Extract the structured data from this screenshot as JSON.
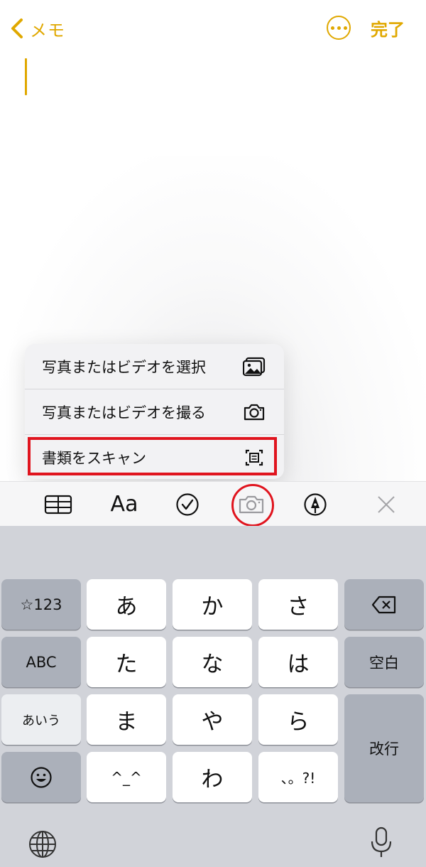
{
  "nav": {
    "back_label": "メモ",
    "done_label": "完了"
  },
  "menu": {
    "items": [
      {
        "label": "写真またはビデオを選択",
        "icon": "photo-library-icon"
      },
      {
        "label": "写真またはビデオを撮る",
        "icon": "camera-icon"
      },
      {
        "label": "書類をスキャン",
        "icon": "scan-document-icon"
      }
    ]
  },
  "toolbar": {
    "format_label": "Aa"
  },
  "keyboard": {
    "symbols": "☆123",
    "abc": "ABC",
    "aiu": "あいう",
    "space": "空白",
    "return": "改行",
    "kana": {
      "a": "あ",
      "ka": "か",
      "sa": "さ",
      "ta": "た",
      "na": "な",
      "ha": "は",
      "ma": "ま",
      "ya": "や",
      "ra": "ら",
      "face": "^_^",
      "wa": "わ",
      "punct": "、。?!"
    }
  },
  "colors": {
    "accent": "#e0a800",
    "highlight": "#e0141e"
  }
}
